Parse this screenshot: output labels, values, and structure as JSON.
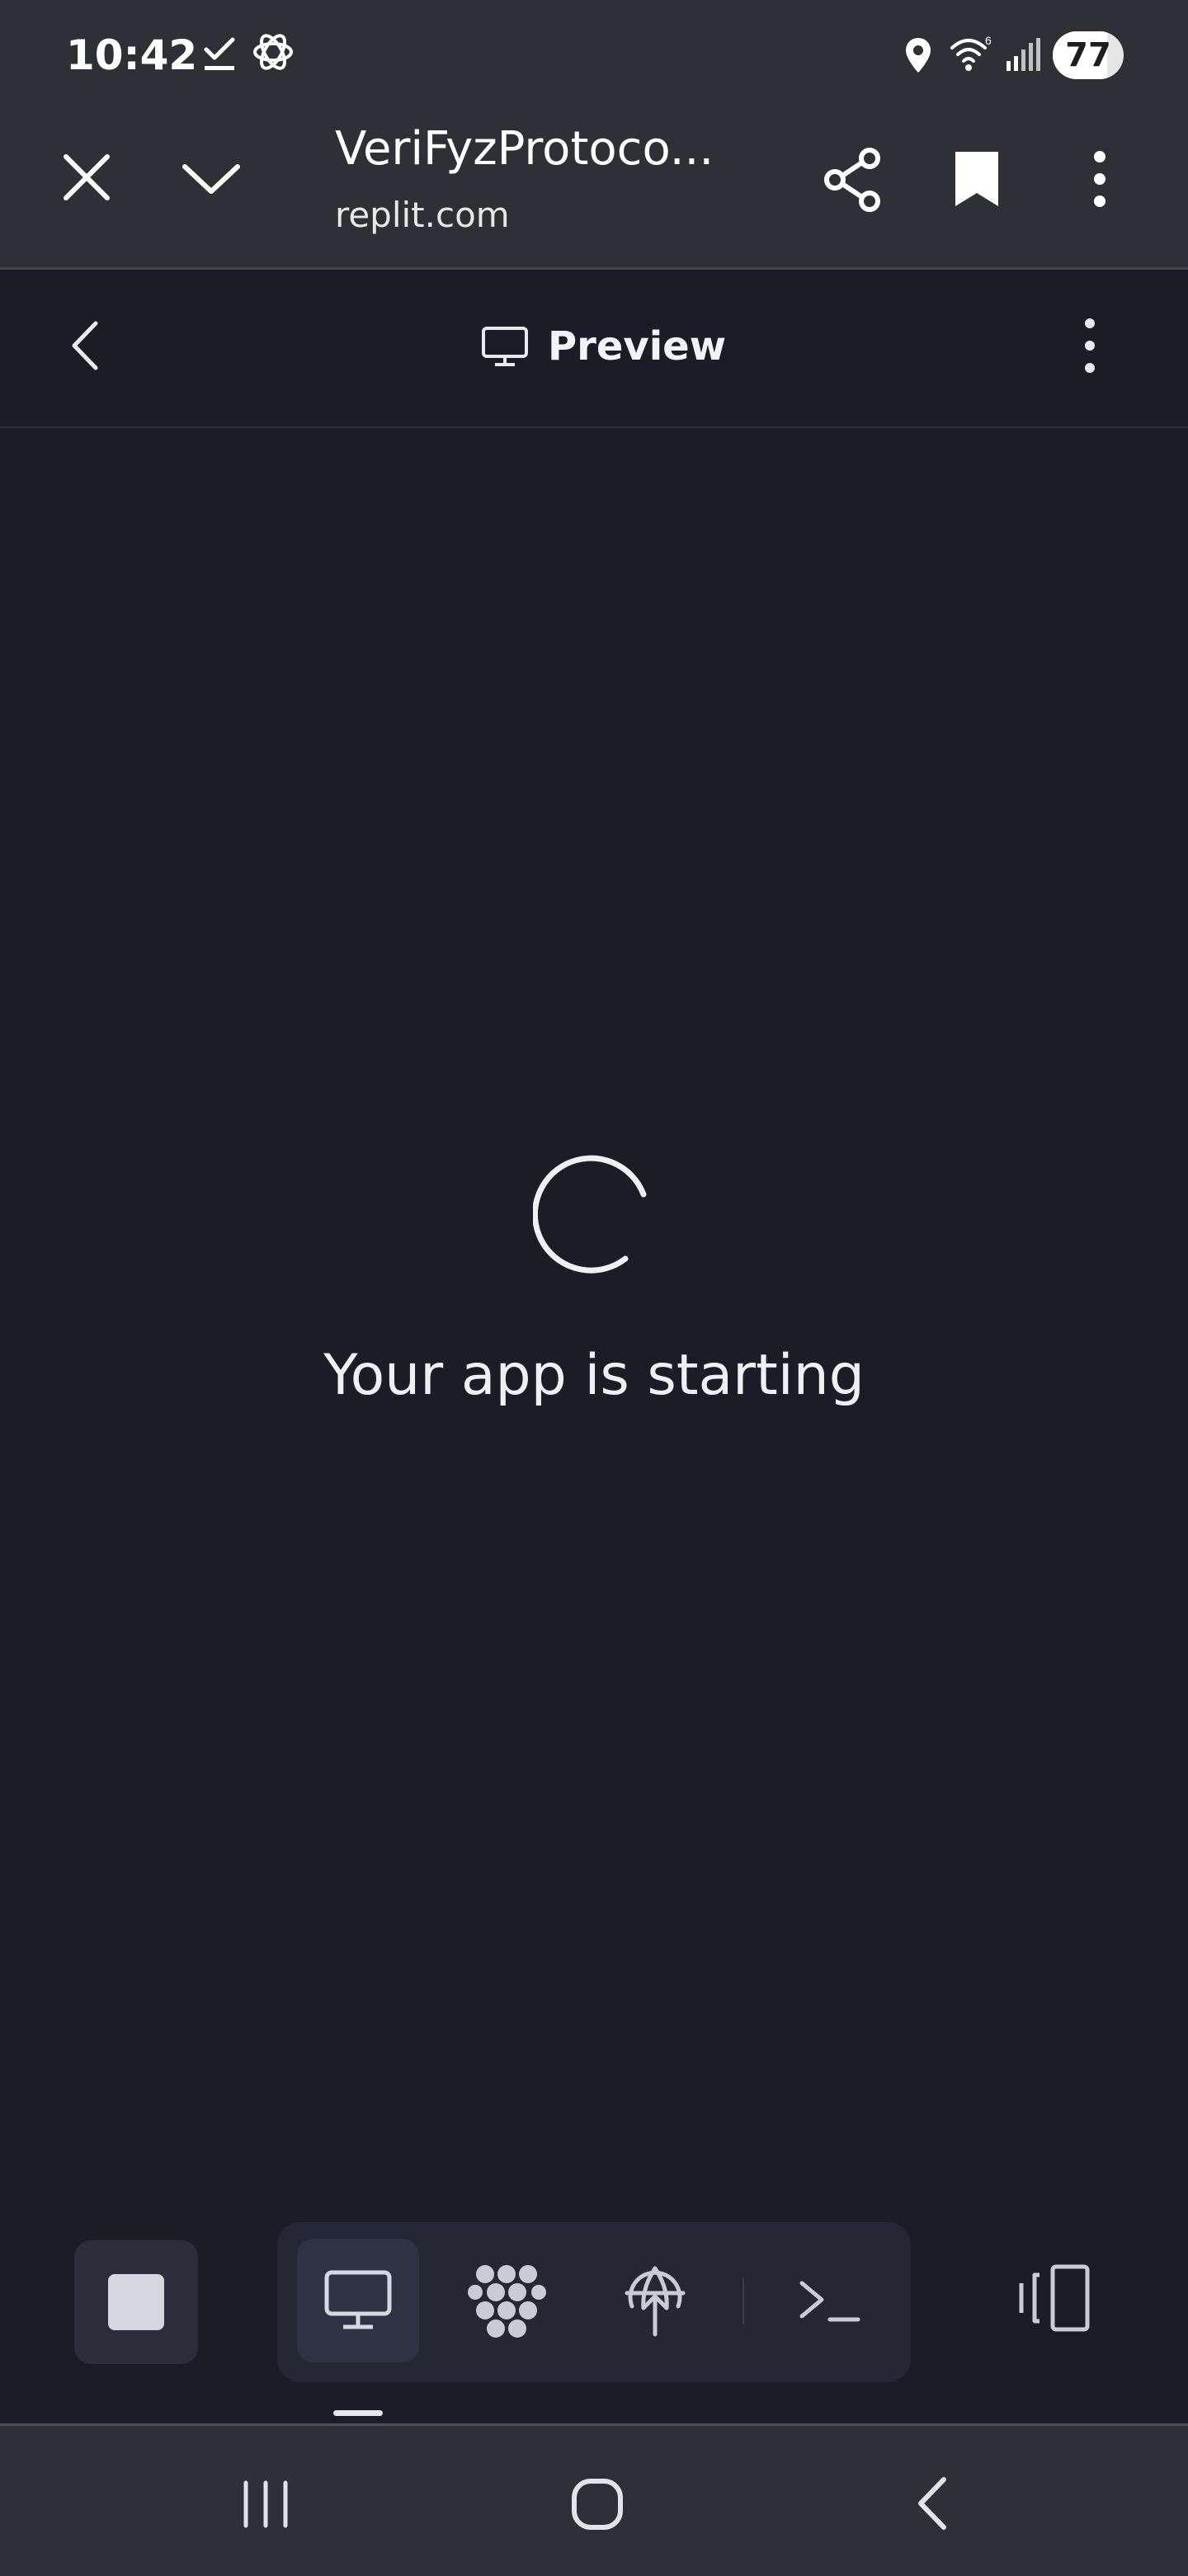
{
  "status_bar": {
    "time": "10:42",
    "battery_level": "77",
    "battery_fraction": 0.77,
    "icons": [
      "checkmark-icon",
      "ai-app-icon",
      "location-icon",
      "wifi-icon",
      "signal-icon",
      "battery-icon"
    ]
  },
  "browser": {
    "title": "VeriFyzProtoco...",
    "domain": "replit.com",
    "icons": [
      "close-icon",
      "chevron-down-icon",
      "share-icon",
      "bookmark-icon",
      "more-vertical-icon"
    ]
  },
  "preview_header": {
    "tab_label": "Preview",
    "icons": [
      "back-chevron-icon",
      "monitor-icon",
      "more-vertical-icon"
    ]
  },
  "main": {
    "loading_text": "Your app is starting"
  },
  "toolbar": {
    "tabs": [
      "preview",
      "packages",
      "deployments",
      "shell"
    ],
    "active_tab": "preview",
    "icons": [
      "stop-icon",
      "monitor-icon",
      "packages-icon",
      "deploy-icon",
      "terminal-icon",
      "layout-toggle-icon"
    ]
  },
  "nav_bar": {
    "icons": [
      "recents-icon",
      "home-icon",
      "back-icon"
    ]
  },
  "colors": {
    "background": "#1b1c26",
    "chrome": "#2f3035",
    "text": "#eef0f4",
    "accent_surface": "#2f3242"
  }
}
